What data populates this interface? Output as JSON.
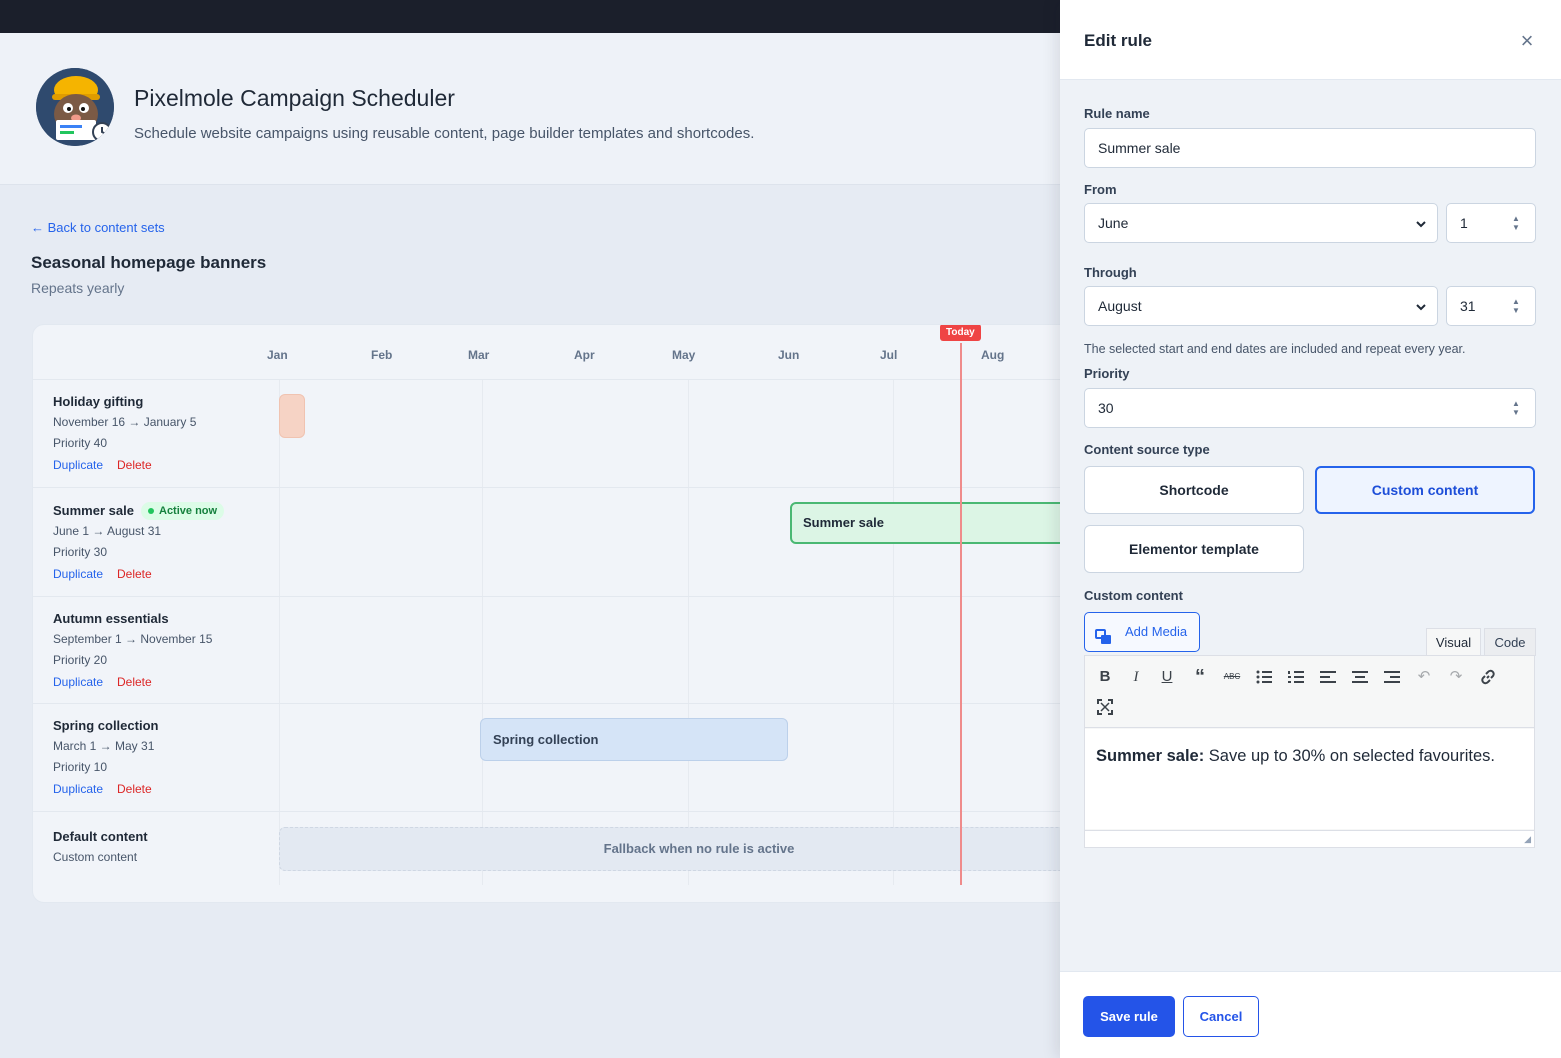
{
  "app": {
    "title": "Pixelmole Campaign Scheduler",
    "subtitle": "Schedule website campaigns using reusable content, page builder templates and shortcodes."
  },
  "content_set": {
    "back_link": "← Back to content sets",
    "title": "Seasonal homepage banners",
    "subtitle": "Repeats yearly"
  },
  "timeline": {
    "months": [
      "Jan",
      "Feb",
      "Mar",
      "Apr",
      "May",
      "Jun",
      "Jul",
      "Aug"
    ],
    "today_label": "Today",
    "duplicate_label": "Duplicate",
    "delete_label": "Delete",
    "rules": [
      {
        "name": "Holiday gifting",
        "dates": "November 16 → January 5",
        "priority": "Priority 40"
      },
      {
        "name": "Summer sale",
        "badge": "Active now",
        "dates": "June 1 → August 31",
        "priority": "Priority 30",
        "bar_label": "Summer sale"
      },
      {
        "name": "Autumn essentials",
        "dates": "September 1 → November 15",
        "priority": "Priority 20"
      },
      {
        "name": "Spring collection",
        "dates": "March 1 → May 31",
        "priority": "Priority 10",
        "bar_label": "Spring collection"
      }
    ],
    "default": {
      "name": "Default content",
      "type": "Custom content",
      "bar_label": "Fallback when no rule is active"
    }
  },
  "panel": {
    "title": "Edit rule",
    "rule_name_label": "Rule name",
    "rule_name_value": "Summer sale",
    "from_label": "From",
    "from_month": "June",
    "from_day": "1",
    "through_label": "Through",
    "through_month": "August",
    "through_day": "31",
    "help_text": "The selected start and end dates are included and repeat every year.",
    "priority_label": "Priority",
    "priority_value": "30",
    "source_type_label": "Content source type",
    "source_options": [
      "Shortcode",
      "Custom content",
      "Elementor template"
    ],
    "source_selected": "Custom content",
    "custom_content_label": "Custom content",
    "add_media_label": "Add Media",
    "tab_visual": "Visual",
    "tab_code": "Code",
    "editor_bold": "Summer sale:",
    "editor_text": " Save up to 30% on selected favourites.",
    "save_label": "Save rule",
    "cancel_label": "Cancel"
  },
  "colors": {
    "primary": "#2454e8",
    "active_green": "#22c55e",
    "today_red": "#ef4444"
  }
}
